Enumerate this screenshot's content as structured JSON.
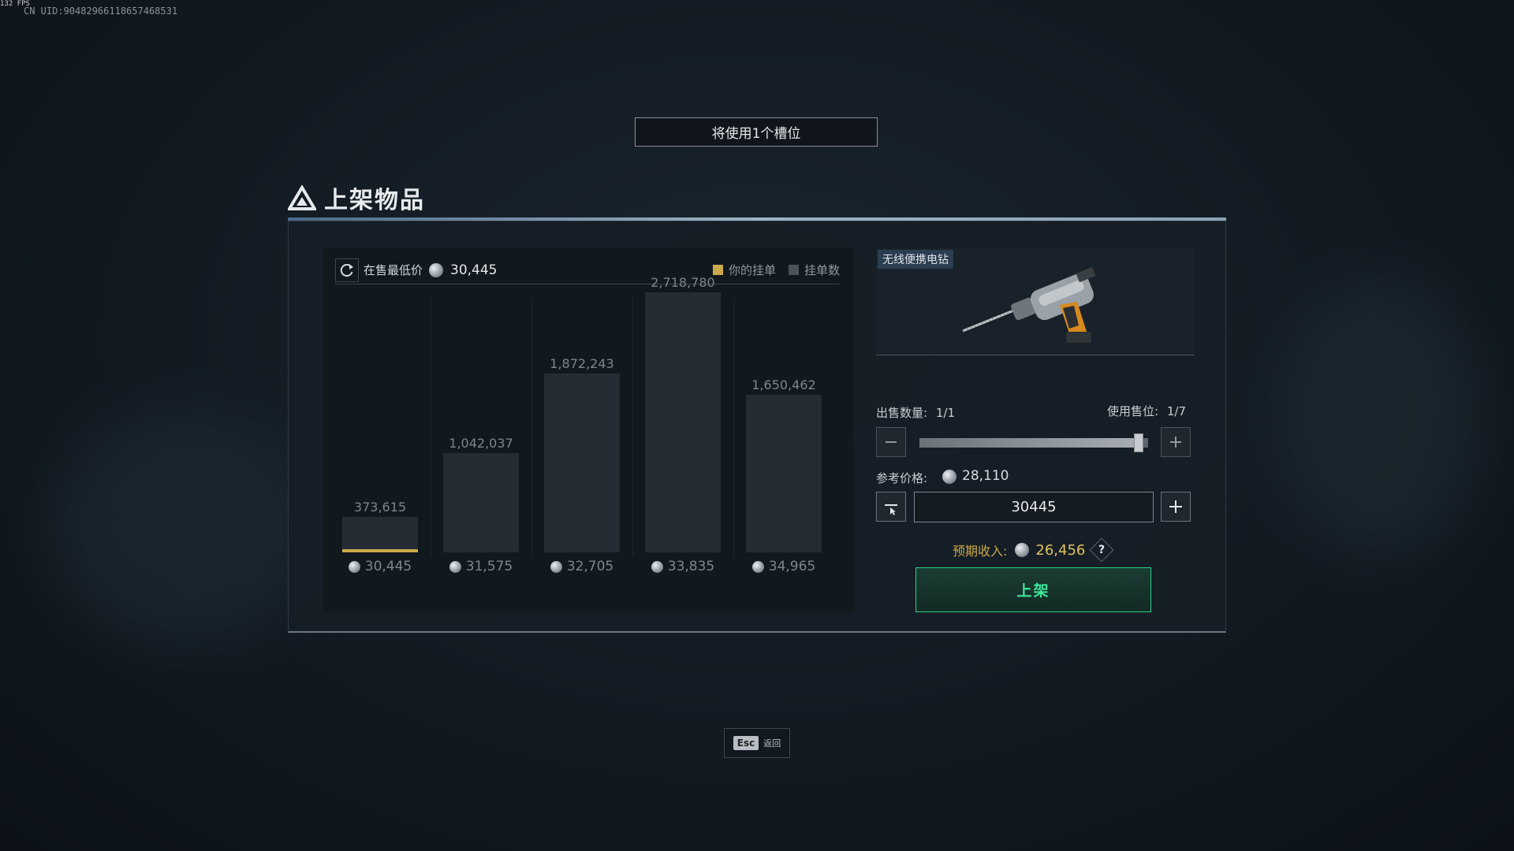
{
  "overlay": {
    "fps": "132 FPS",
    "uid": "CN UID:90482966118657468531"
  },
  "banner": {
    "text": "将使用1个槽位"
  },
  "panel": {
    "title": "上架物品"
  },
  "chart": {
    "lowest_label": "在售最低价",
    "lowest_value": "30,445",
    "legend": {
      "yours": "你的挂单",
      "count": "挂单数"
    },
    "colors": {
      "yours": "#c9a94a",
      "count": "#4b535a"
    }
  },
  "chart_data": {
    "type": "bar",
    "categories": [
      "30,445",
      "31,575",
      "32,705",
      "33,835",
      "34,965"
    ],
    "values": [
      373615,
      1042037,
      1872243,
      2718780,
      1650462
    ],
    "value_labels": [
      "373,615",
      "1,042,037",
      "1,872,243",
      "2,718,780",
      "1,650,462"
    ],
    "series": [
      {
        "name": "挂单数",
        "values": [
          373615,
          1042037,
          1872243,
          2718780,
          1650462
        ]
      }
    ],
    "your_listing_index": 0
  },
  "item": {
    "name": "无线便携电钻"
  },
  "quantity": {
    "label": "出售数量:",
    "value": "1/1",
    "fill": 1.0
  },
  "slots": {
    "label": "使用售位:",
    "value": "1/7"
  },
  "reference": {
    "label": "参考价格:",
    "value": "28,110"
  },
  "price_input": {
    "value": "30445"
  },
  "income": {
    "label": "预期收入:",
    "value": "26,456",
    "help": "?"
  },
  "list_button": {
    "label": "上架"
  },
  "footer": {
    "esc_key": "Esc",
    "esc_label": "返回"
  }
}
